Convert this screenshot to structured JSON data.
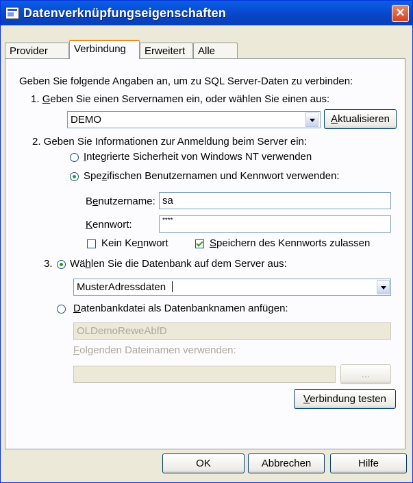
{
  "window": {
    "title": "Datenverknüpfungseigenschaften",
    "close_glyph": "✕"
  },
  "tabs": [
    "Provider",
    "Verbindung",
    "Erweitert",
    "Alle"
  ],
  "active_tab": "Verbindung",
  "intro": "Geben Sie folgende Angaben an, um zu SQL Server-Daten zu verbinden:",
  "step1": {
    "number": "1.",
    "label_key": "G",
    "label_rest": "eben Sie einen Servernamen ein, oder wählen Sie einen aus:",
    "server_value": "DEMO",
    "refresh_key": "A",
    "refresh_rest": "ktualisieren"
  },
  "step2": {
    "label": "2. Geben Sie Informationen zur Anmeldung beim Server ein:",
    "option_nt_key": "I",
    "option_nt_rest": "ntegrierte Sicherheit von Windows NT verwenden",
    "option_specific_pre": "Spe",
    "option_specific_key": "z",
    "option_specific_rest": "ifischen Benutzernamen und Kennwort verwenden:",
    "username_pre": "B",
    "username_key": "e",
    "username_rest": "nutzername:",
    "username_value": "sa",
    "password_key": "K",
    "password_rest": "ennwort:",
    "password_value": "****",
    "no_password_pre": "Kein Ke",
    "no_password_key": "n",
    "no_password_rest": "nwort",
    "save_password_key": "S",
    "save_password_rest": "peichern des Kennworts zulassen"
  },
  "step3": {
    "number": "3.",
    "option_db_pre": "Wä",
    "option_db_key": "h",
    "option_db_rest": "len Sie die Datenbank auf dem Server aus:",
    "database_value": "MusterAdressdaten",
    "option_file_key": "D",
    "option_file_rest": "atenbankdatei als Datenbanknamen anfügen:",
    "file_value": "OLDemoReweAbfD",
    "filename_key": "F",
    "filename_rest": "olgenden Dateinamen verwenden:",
    "filename_value": "",
    "browse_label": "..."
  },
  "test_button_key": "V",
  "test_button_rest": "erbindung testen",
  "buttons": {
    "ok": "OK",
    "cancel": "Abbrechen",
    "help": "Hilfe"
  },
  "state": {
    "auth_mode": "specific",
    "no_password_checked": false,
    "save_password_checked": true,
    "db_mode": "select"
  }
}
